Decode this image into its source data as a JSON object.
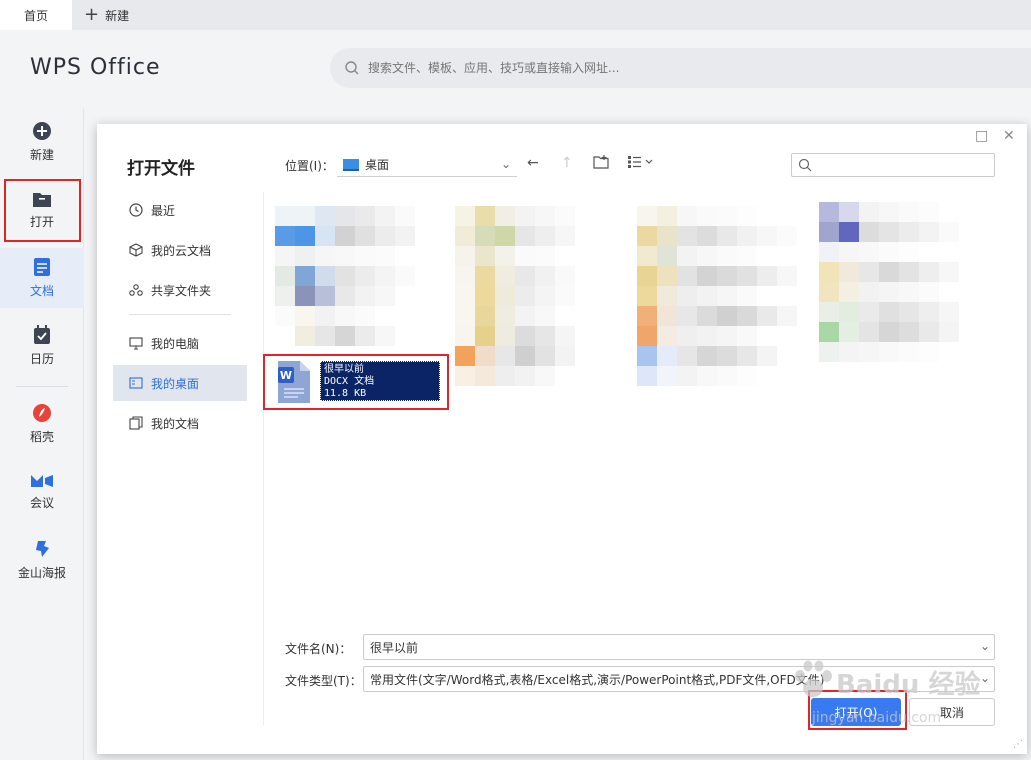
{
  "tabs": {
    "home": "首页",
    "new": "新建"
  },
  "header": {
    "logo": "WPS Office",
    "search_placeholder": "搜索文件、模板、应用、技巧或直接输入网址..."
  },
  "leftnav": {
    "new": "新建",
    "open": "打开",
    "docs": "文档",
    "calendar": "日历",
    "daoke": "稻壳",
    "meeting": "会议",
    "poster": "金山海报"
  },
  "dialog": {
    "title": "打开文件",
    "sidebar": {
      "recent": "最近",
      "cloud": "我的云文档",
      "shared": "共享文件夹",
      "computer": "我的电脑",
      "desktop": "我的桌面",
      "documents": "我的文档"
    },
    "location_label": "位置(I)：",
    "location_value": "桌面",
    "file": {
      "name": "很早以前",
      "type": "DOCX 文档",
      "size": "11.8 KB"
    },
    "filename_label": "文件名(N)：",
    "filename_value": "很早以前",
    "filetype_label": "文件类型(T)：",
    "filetype_value": "常用文件(文字/Word格式,表格/Excel格式,演示/PowerPoint格式,PDF文件,OFD文件)",
    "open_button": "打开(O)",
    "cancel_button": "取消"
  },
  "watermark": {
    "main": "Baidu 经验",
    "sub": "jingyan.baidu.com"
  },
  "colors": {
    "accent": "#3a7af0",
    "highlight": "#e0242a",
    "selection": "#0b2466"
  }
}
